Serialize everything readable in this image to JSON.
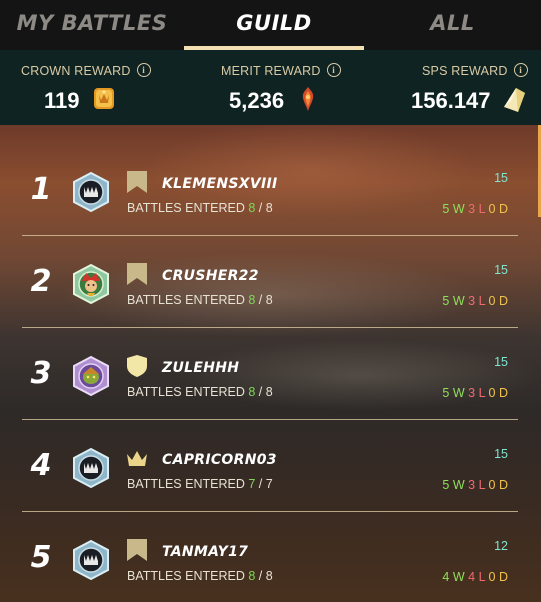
{
  "tabs": [
    {
      "label": "MY BATTLES",
      "active": false
    },
    {
      "label": "GUILD",
      "active": true
    },
    {
      "label": "ALL",
      "active": false
    }
  ],
  "rewards": {
    "crown": {
      "label": "CROWN REWARD",
      "value": "119",
      "icon": "crown-token-icon"
    },
    "merit": {
      "label": "MERIT REWARD",
      "value": "5,236",
      "icon": "merit-icon"
    },
    "sps": {
      "label": "SPS REWARD",
      "value": "156.147",
      "icon": "sps-crystal-icon"
    }
  },
  "battles_label": "BATTLES ENTERED",
  "players": [
    {
      "rank": "1",
      "name": "KLEMENSXVIII",
      "entered": "8",
      "total": "8",
      "score": "15",
      "w": "5",
      "l": "3",
      "d": "0",
      "guild_icon": "banner-icon",
      "avatar": "monster-avatar"
    },
    {
      "rank": "2",
      "name": "CRUSHER22",
      "entered": "8",
      "total": "8",
      "score": "15",
      "w": "5",
      "l": "3",
      "d": "0",
      "guild_icon": "banner-icon",
      "avatar": "jester-avatar"
    },
    {
      "rank": "3",
      "name": "ZULEHHH",
      "entered": "8",
      "total": "8",
      "score": "15",
      "w": "5",
      "l": "3",
      "d": "0",
      "guild_icon": "shield-icon",
      "avatar": "goblin-avatar"
    },
    {
      "rank": "4",
      "name": "CAPRICORN03",
      "entered": "7",
      "total": "7",
      "score": "15",
      "w": "5",
      "l": "3",
      "d": "0",
      "guild_icon": "crown-icon",
      "avatar": "monster-avatar"
    },
    {
      "rank": "5",
      "name": "TANMAY17",
      "entered": "8",
      "total": "8",
      "score": "12",
      "w": "4",
      "l": "4",
      "d": "0",
      "guild_icon": "banner-icon",
      "avatar": "monster-avatar"
    }
  ],
  "colors": {
    "accent": "#f3dfb2",
    "score": "#7fe6d0",
    "win": "#8ee05a",
    "loss": "#f06a72",
    "draw": "#f2c24a",
    "guild_icon": "#c9b98a"
  }
}
